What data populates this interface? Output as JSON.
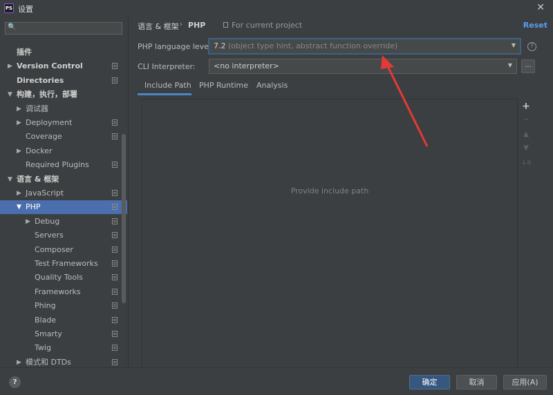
{
  "window": {
    "title": "设置",
    "app_icon_text": "PS",
    "close_glyph": "✕"
  },
  "sidebar": {
    "search": {
      "value": "",
      "icon_glyph": "🔍"
    },
    "items": [
      {
        "label": "插件",
        "bold": true,
        "arrow": "",
        "copy": false
      },
      {
        "label": "Version Control",
        "bold": true,
        "arrow": "▶",
        "copy": true
      },
      {
        "label": "Directories",
        "bold": true,
        "arrow": "",
        "copy": true
      },
      {
        "label": "构建，执行，部署",
        "bold": true,
        "arrow": "▼",
        "copy": false
      },
      {
        "label": "调试器",
        "bold": false,
        "arrow": "▶",
        "copy": false
      },
      {
        "label": "Deployment",
        "bold": false,
        "arrow": "▶",
        "copy": true
      },
      {
        "label": "Coverage",
        "bold": false,
        "arrow": "",
        "copy": true
      },
      {
        "label": "Docker",
        "bold": false,
        "arrow": "▶",
        "copy": false
      },
      {
        "label": "Required Plugins",
        "bold": false,
        "arrow": "",
        "copy": true
      },
      {
        "label": "语言 & 框架",
        "bold": true,
        "arrow": "▼",
        "copy": false
      },
      {
        "label": "JavaScript",
        "bold": false,
        "arrow": "▶",
        "copy": true
      },
      {
        "label": "PHP",
        "bold": false,
        "arrow": "▼",
        "copy": true,
        "selected": true
      },
      {
        "label": "Debug",
        "bold": false,
        "arrow": "▶",
        "copy": true
      },
      {
        "label": "Servers",
        "bold": false,
        "arrow": "",
        "copy": true
      },
      {
        "label": "Composer",
        "bold": false,
        "arrow": "",
        "copy": true
      },
      {
        "label": "Test Frameworks",
        "bold": false,
        "arrow": "",
        "copy": true
      },
      {
        "label": "Quality Tools",
        "bold": false,
        "arrow": "",
        "copy": true
      },
      {
        "label": "Frameworks",
        "bold": false,
        "arrow": "",
        "copy": true
      },
      {
        "label": "Phing",
        "bold": false,
        "arrow": "",
        "copy": true
      },
      {
        "label": "Blade",
        "bold": false,
        "arrow": "",
        "copy": true
      },
      {
        "label": "Smarty",
        "bold": false,
        "arrow": "",
        "copy": true
      },
      {
        "label": "Twig",
        "bold": false,
        "arrow": "",
        "copy": true
      },
      {
        "label": "模式和 DTDs",
        "bold": false,
        "arrow": "▶",
        "copy": true
      }
    ]
  },
  "main": {
    "breadcrumb": {
      "parent": "语言 & 框架",
      "separator": "›",
      "current": "PHP"
    },
    "scope_text": "For current project",
    "reset_label": "Reset",
    "php_level": {
      "label": "PHP language level:",
      "version": "7.2",
      "hint": "(object type hint, abstract function override)"
    },
    "cli": {
      "label": "CLI Interpreter:",
      "value": "<no interpreter>",
      "browse_label": "..."
    },
    "help_glyph": "?",
    "tabs": [
      {
        "label": "Include Path",
        "active": true
      },
      {
        "label": "PHP Runtime",
        "active": false
      },
      {
        "label": "Analysis",
        "active": false
      }
    ],
    "empty_text": "Provide include path",
    "tools": {
      "add": "+",
      "remove": "−",
      "up": "▲",
      "down": "▼",
      "sort": "↓a"
    }
  },
  "footer": {
    "help_glyph": "?",
    "ok_label": "确定",
    "cancel_label": "取消",
    "apply_label": "应用(A)"
  },
  "colors": {
    "background": "#3c3f41",
    "selection": "#4b6eaf",
    "link": "#589df6",
    "annotation_arrow": "#e53935"
  }
}
